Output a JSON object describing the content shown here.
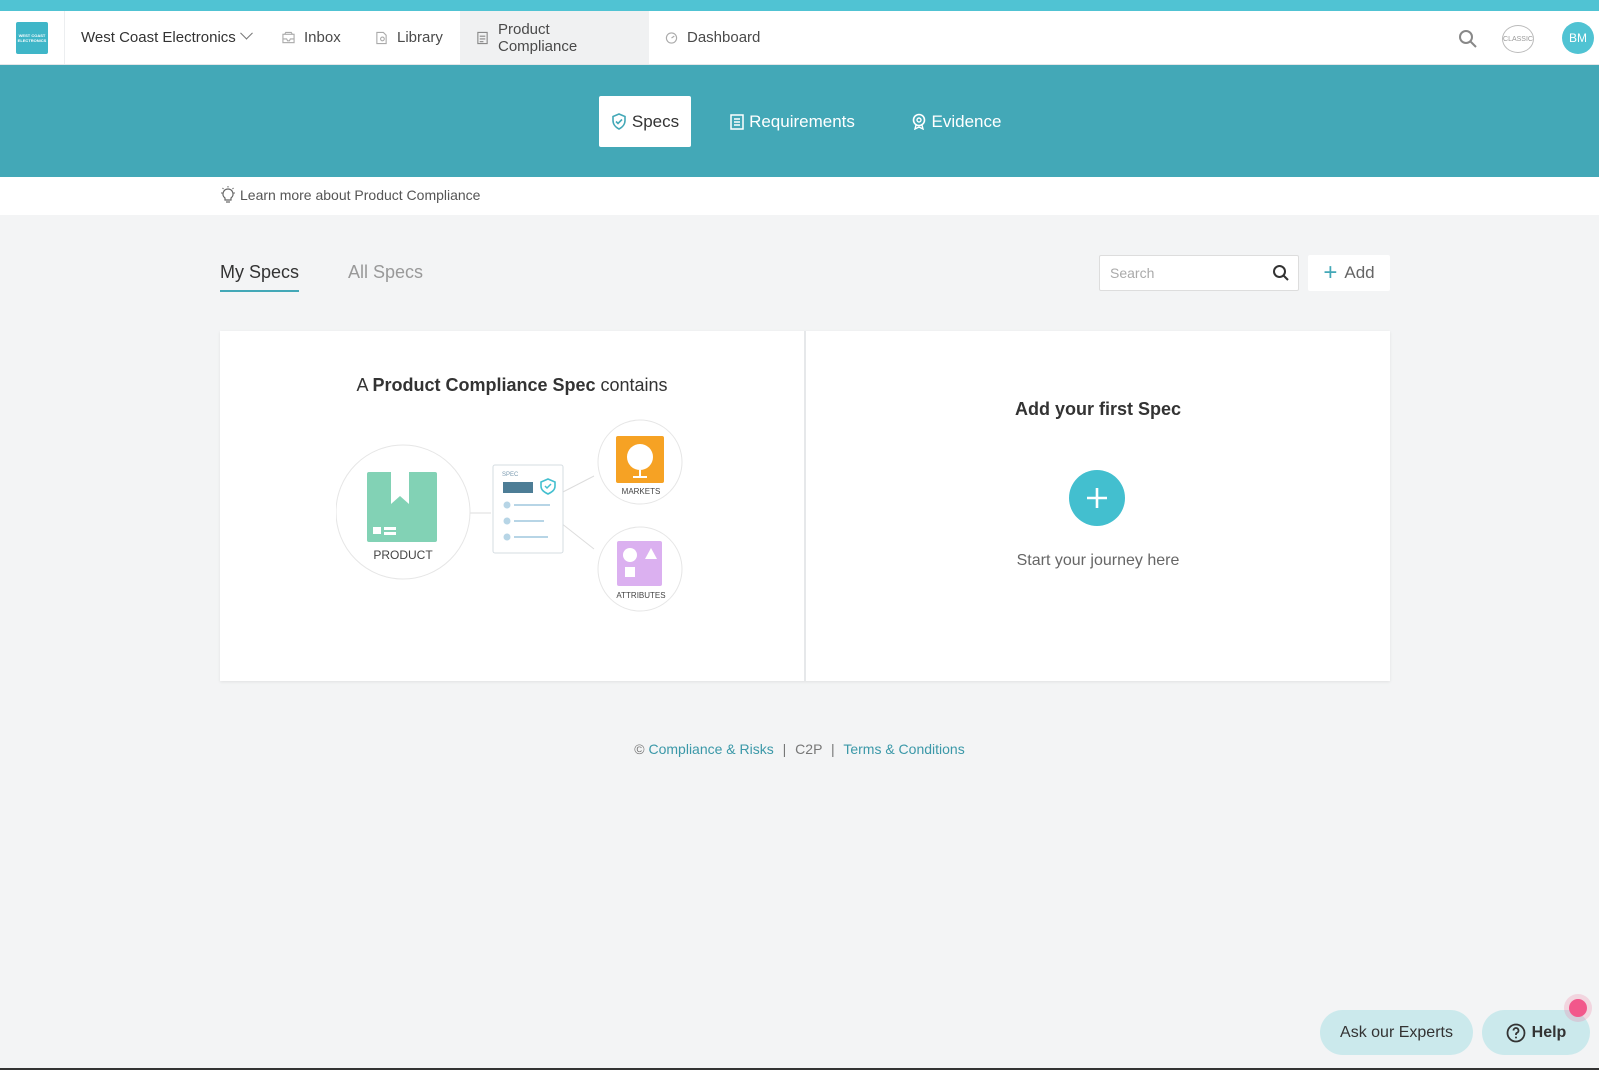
{
  "topnav": {
    "company": "West Coast Electronics",
    "logo_text": "WEST COAST ELECTRONICS",
    "tabs": [
      {
        "label": "Inbox",
        "icon": "inbox-icon"
      },
      {
        "label": "Library",
        "icon": "library-icon"
      },
      {
        "label": "Product Compliance",
        "icon": "document-icon",
        "active": true
      },
      {
        "label": "Dashboard",
        "icon": "dashboard-icon"
      }
    ],
    "classic_label": "CLASSIC",
    "avatar_initials": "BM"
  },
  "subnav": {
    "tabs": [
      {
        "label": "Specs",
        "icon": "shield-icon",
        "active": true
      },
      {
        "label": "Requirements",
        "icon": "list-icon"
      },
      {
        "label": "Evidence",
        "icon": "badge-icon"
      }
    ]
  },
  "learn_more": "Learn more about Product Compliance",
  "specs_tabs": {
    "my": "My Specs",
    "all": "All Specs"
  },
  "search": {
    "placeholder": "Search"
  },
  "add_label": "Add",
  "intro": {
    "prefix": "A ",
    "bold": "Product Compliance Spec",
    "suffix": " contains",
    "labels": {
      "product": "PRODUCT",
      "spec": "SPEC",
      "markets": "MARKETS",
      "attributes": "ATTRIBUTES"
    }
  },
  "empty": {
    "title": "Add your first Spec",
    "subtitle": "Start your journey here"
  },
  "footer": {
    "copyright": "©",
    "company_link": "Compliance & Risks",
    "c2p": "C2P",
    "terms_link": "Terms & Conditions"
  },
  "help": {
    "ask": "Ask our Experts",
    "help": "Help"
  },
  "colors": {
    "accent": "#43a8b7",
    "stripe": "#50c3d3",
    "background": "#f3f4f5",
    "notification": "#f2578b"
  }
}
